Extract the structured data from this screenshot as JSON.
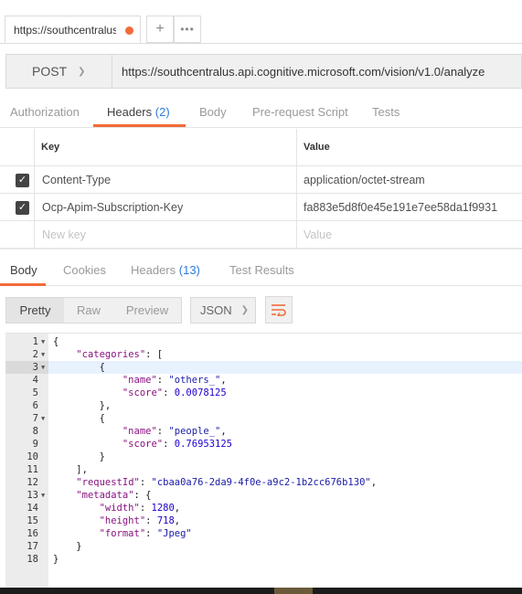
{
  "request_tab": {
    "title": "https://southcentralus",
    "plus": "+",
    "more": "•••"
  },
  "request": {
    "method": "POST",
    "url": "https://southcentralus.api.cognitive.microsoft.com/vision/v1.0/analyze"
  },
  "request_tabs": {
    "authorization": "Authorization",
    "headers": "Headers",
    "headers_count": "(2)",
    "body": "Body",
    "prerequest": "Pre-request Script",
    "tests": "Tests"
  },
  "headers_table": {
    "key_header": "Key",
    "value_header": "Value",
    "rows": [
      {
        "key": "Content-Type",
        "value": "application/octet-stream",
        "checked": true
      },
      {
        "key": "Ocp-Apim-Subscription-Key",
        "value": "fa883e5d8f0e45e191e7ee58da1f9931",
        "checked": true
      }
    ],
    "new_key_placeholder": "New key",
    "new_value_placeholder": "Value"
  },
  "response_tabs": {
    "body": "Body",
    "cookies": "Cookies",
    "headers": "Headers",
    "headers_count": "(13)",
    "test_results": "Test Results"
  },
  "response_toolbar": {
    "pretty": "Pretty",
    "raw": "Raw",
    "preview": "Preview",
    "format": "JSON"
  },
  "response_body_lines": [
    {
      "n": "1",
      "fold": true,
      "indent": "",
      "tokens": [
        [
          "p",
          "{"
        ]
      ]
    },
    {
      "n": "2",
      "fold": true,
      "indent": "    ",
      "tokens": [
        [
          "k",
          "\"categories\""
        ],
        [
          "p",
          ": ["
        ]
      ]
    },
    {
      "n": "3",
      "fold": true,
      "indent": "        ",
      "tokens": [
        [
          "p",
          "{"
        ]
      ],
      "current": true
    },
    {
      "n": "4",
      "fold": false,
      "indent": "            ",
      "tokens": [
        [
          "k",
          "\"name\""
        ],
        [
          "p",
          ": "
        ],
        [
          "s",
          "\"others_\""
        ],
        [
          "p",
          ","
        ]
      ]
    },
    {
      "n": "5",
      "fold": false,
      "indent": "            ",
      "tokens": [
        [
          "k",
          "\"score\""
        ],
        [
          "p",
          ": "
        ],
        [
          "n",
          "0.0078125"
        ]
      ]
    },
    {
      "n": "6",
      "fold": false,
      "indent": "        ",
      "tokens": [
        [
          "p",
          "},"
        ]
      ]
    },
    {
      "n": "7",
      "fold": true,
      "indent": "        ",
      "tokens": [
        [
          "p",
          "{"
        ]
      ]
    },
    {
      "n": "8",
      "fold": false,
      "indent": "            ",
      "tokens": [
        [
          "k",
          "\"name\""
        ],
        [
          "p",
          ": "
        ],
        [
          "s",
          "\"people_\""
        ],
        [
          "p",
          ","
        ]
      ]
    },
    {
      "n": "9",
      "fold": false,
      "indent": "            ",
      "tokens": [
        [
          "k",
          "\"score\""
        ],
        [
          "p",
          ": "
        ],
        [
          "n",
          "0.76953125"
        ]
      ]
    },
    {
      "n": "10",
      "fold": false,
      "indent": "        ",
      "tokens": [
        [
          "p",
          "}"
        ]
      ]
    },
    {
      "n": "11",
      "fold": false,
      "indent": "    ",
      "tokens": [
        [
          "p",
          "],"
        ]
      ]
    },
    {
      "n": "12",
      "fold": false,
      "indent": "    ",
      "tokens": [
        [
          "k",
          "\"requestId\""
        ],
        [
          "p",
          ": "
        ],
        [
          "s",
          "\"cbaa0a76-2da9-4f0e-a9c2-1b2cc676b130\""
        ],
        [
          "p",
          ","
        ]
      ]
    },
    {
      "n": "13",
      "fold": true,
      "indent": "    ",
      "tokens": [
        [
          "k",
          "\"metadata\""
        ],
        [
          "p",
          ": {"
        ]
      ]
    },
    {
      "n": "14",
      "fold": false,
      "indent": "        ",
      "tokens": [
        [
          "k",
          "\"width\""
        ],
        [
          "p",
          ": "
        ],
        [
          "n",
          "1280"
        ],
        [
          "p",
          ","
        ]
      ]
    },
    {
      "n": "15",
      "fold": false,
      "indent": "        ",
      "tokens": [
        [
          "k",
          "\"height\""
        ],
        [
          "p",
          ": "
        ],
        [
          "n",
          "718"
        ],
        [
          "p",
          ","
        ]
      ]
    },
    {
      "n": "16",
      "fold": false,
      "indent": "        ",
      "tokens": [
        [
          "k",
          "\"format\""
        ],
        [
          "p",
          ": "
        ],
        [
          "s",
          "\"Jpeg\""
        ]
      ]
    },
    {
      "n": "17",
      "fold": false,
      "indent": "    ",
      "tokens": [
        [
          "p",
          "}"
        ]
      ]
    },
    {
      "n": "18",
      "fold": false,
      "indent": "",
      "tokens": [
        [
          "p",
          "}"
        ]
      ]
    }
  ],
  "colors": {
    "accent": "#f26b3a",
    "count_blue": "#2b7bd8"
  }
}
